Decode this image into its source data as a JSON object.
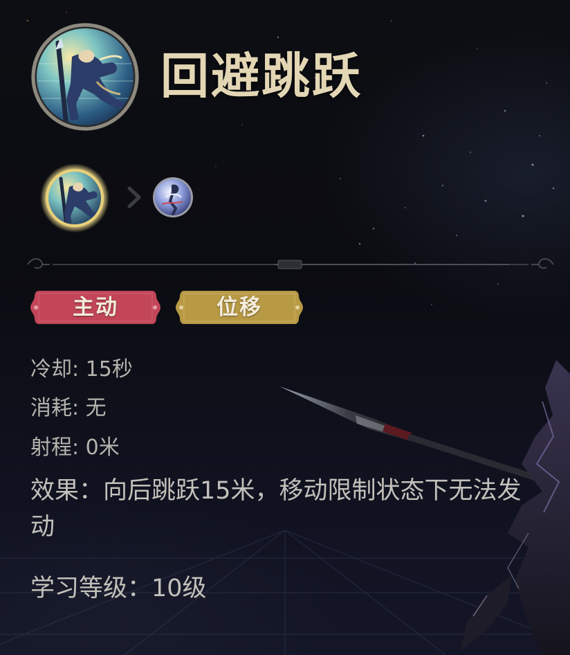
{
  "skill": {
    "name": "回避跳跃",
    "icon": "leaping-swordsman-icon"
  },
  "evolution": {
    "current_icon": "leaping-swordsman-icon",
    "arrow_icon": "chevron-right-icon",
    "next_icon": "twirling-figure-icon"
  },
  "tags": [
    {
      "label": "主动",
      "color": "#c24658"
    },
    {
      "label": "位移",
      "color": "#b89a45"
    }
  ],
  "stats": {
    "cooldown": "冷却: 15秒",
    "cost": "消耗: 无",
    "range": "射程: 0米"
  },
  "effect": "效果：向后跳跃15米，移动限制状态下无法发动",
  "learn_level": "学习等级：10级",
  "colors": {
    "title": "#e3d6b4",
    "text": "#c3c1bb",
    "tag_active": "#c24658",
    "tag_move": "#b89a45",
    "icon_glow": "#f3df8e"
  }
}
